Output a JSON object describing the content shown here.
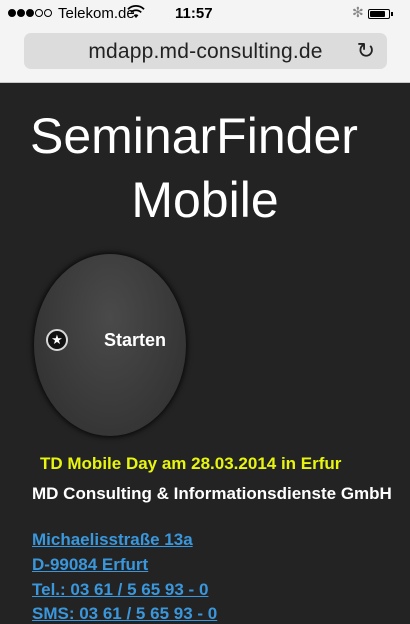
{
  "status_bar": {
    "carrier": "Telekom.de",
    "time": "11:57",
    "signal_bars": 3,
    "signal_total": 5,
    "battery_level": 0.85,
    "icons": [
      "wifi-icon",
      "bluetooth-icon",
      "battery-icon"
    ]
  },
  "browser": {
    "url": "mdapp.md-consulting.de",
    "reload_icon": "reload-icon"
  },
  "page": {
    "title": "SeminarFinder",
    "subtitle": "Mobile",
    "start_button": {
      "label": "Starten",
      "icon": "star-icon"
    },
    "event_banner": "TD Mobile Day am 28.03.2014 in Erfur",
    "company_name": "MD Consulting & Informationsdienste GmbH",
    "contact_links": [
      "Michaelisstraße 13a",
      "D-99084 Erfurt",
      "Tel.: 03 61 / 5 65 93 - 0",
      "SMS: 03 61 / 5 65 93 - 0"
    ],
    "colors": {
      "background": "#232323",
      "banner": "#e7f50f",
      "link": "#3a97dc"
    }
  }
}
